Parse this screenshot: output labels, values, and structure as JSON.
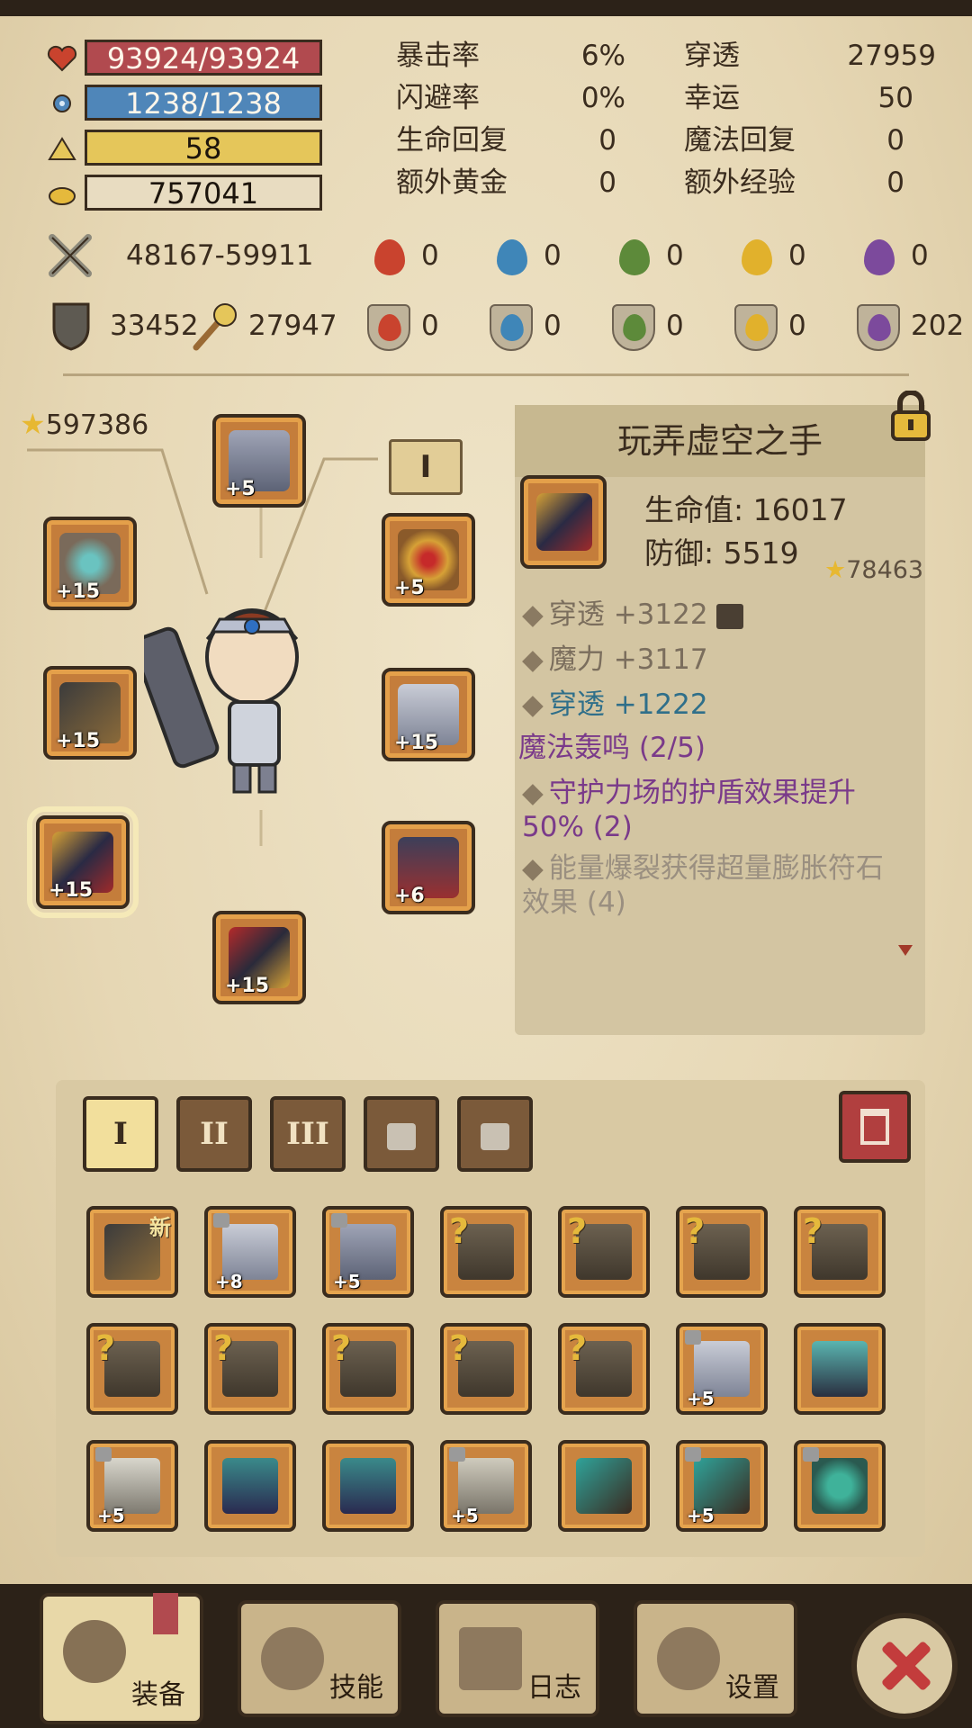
{
  "top_bars": {
    "hp": "93924/93924",
    "mp": "1238/1238",
    "level": "58",
    "gold": "757041"
  },
  "stats": [
    {
      "label": "暴击率",
      "value": "6%"
    },
    {
      "label": "穿透",
      "value": "27959"
    },
    {
      "label": "闪避率",
      "value": "0%"
    },
    {
      "label": "幸运",
      "value": "50"
    },
    {
      "label": "生命回复",
      "value": "0"
    },
    {
      "label": "魔法回复",
      "value": "0"
    },
    {
      "label": "额外黄金",
      "value": "0"
    },
    {
      "label": "额外经验",
      "value": "0"
    }
  ],
  "attack": {
    "range": "48167-59911",
    "elements": [
      "0",
      "0",
      "0",
      "0",
      "0"
    ]
  },
  "defense": {
    "armor": "33452",
    "magic": "27947",
    "elements": [
      "0",
      "0",
      "0",
      "0",
      "202"
    ]
  },
  "element_colors": [
    "#c9432e",
    "#3f86b8",
    "#5d8a3a",
    "#e1b12c",
    "#7c4a9c"
  ],
  "power": "597386",
  "set_badge": "I",
  "equipment": [
    {
      "name": "crown",
      "level": "+5"
    },
    {
      "name": "ring",
      "level": "+15"
    },
    {
      "name": "amulet",
      "level": "+5"
    },
    {
      "name": "weapon",
      "level": "+15"
    },
    {
      "name": "wings",
      "level": "+15"
    },
    {
      "name": "gauntlet",
      "level": "+15"
    },
    {
      "name": "armor",
      "level": "+6"
    },
    {
      "name": "boots",
      "level": "+15"
    }
  ],
  "item_detail": {
    "title": "玩弄虚空之手",
    "hp": "生命值: 16017",
    "defense": "防御: 5519",
    "score": "78463",
    "affixes": [
      "穿透 +3122",
      "魔力 +3117",
      "穿透 +1222"
    ],
    "set_name": "魔法轰鸣 (2/5)",
    "set_bonus_1": "守护力场的护盾效果提升50% (2)",
    "set_bonus_2": "能量爆裂获得超量膨胀符石效果 (4)"
  },
  "inventory_tabs": [
    "I",
    "II",
    "III"
  ],
  "inventory": [
    {
      "kind": "sword",
      "level": "",
      "new": "新",
      "locked": false,
      "unknown": false
    },
    {
      "kind": "wings",
      "level": "+8",
      "locked": true,
      "unknown": false
    },
    {
      "kind": "crown",
      "level": "+5",
      "locked": true,
      "unknown": false
    },
    {
      "kind": "unknown",
      "level": "",
      "locked": false,
      "unknown": true
    },
    {
      "kind": "unknown",
      "level": "",
      "locked": false,
      "unknown": true
    },
    {
      "kind": "unknown",
      "level": "",
      "locked": false,
      "unknown": true
    },
    {
      "kind": "unknown",
      "level": "",
      "locked": false,
      "unknown": true
    },
    {
      "kind": "unknown",
      "level": "",
      "locked": false,
      "unknown": true
    },
    {
      "kind": "unknown",
      "level": "",
      "locked": false,
      "unknown": true
    },
    {
      "kind": "unknown",
      "level": "",
      "locked": false,
      "unknown": true
    },
    {
      "kind": "unknown",
      "level": "",
      "locked": false,
      "unknown": true
    },
    {
      "kind": "unknown",
      "level": "",
      "locked": false,
      "unknown": true
    },
    {
      "kind": "wings",
      "level": "+5",
      "locked": true,
      "unknown": false
    },
    {
      "kind": "chestplate",
      "level": "",
      "locked": false,
      "unknown": false
    },
    {
      "kind": "armor",
      "level": "+5",
      "locked": true,
      "unknown": false
    },
    {
      "kind": "boots",
      "level": "",
      "locked": false,
      "unknown": false
    },
    {
      "kind": "boots",
      "level": "",
      "locked": false,
      "unknown": false
    },
    {
      "kind": "legs",
      "level": "+5",
      "locked": true,
      "unknown": false
    },
    {
      "kind": "gauntlet",
      "level": "",
      "locked": false,
      "unknown": false
    },
    {
      "kind": "gauntlet",
      "level": "+5",
      "locked": true,
      "unknown": false
    },
    {
      "kind": "ring",
      "level": "",
      "locked": true,
      "unknown": false
    }
  ],
  "nav": {
    "equip": "装备",
    "skills": "技能",
    "log": "日志",
    "settings": "设置"
  }
}
